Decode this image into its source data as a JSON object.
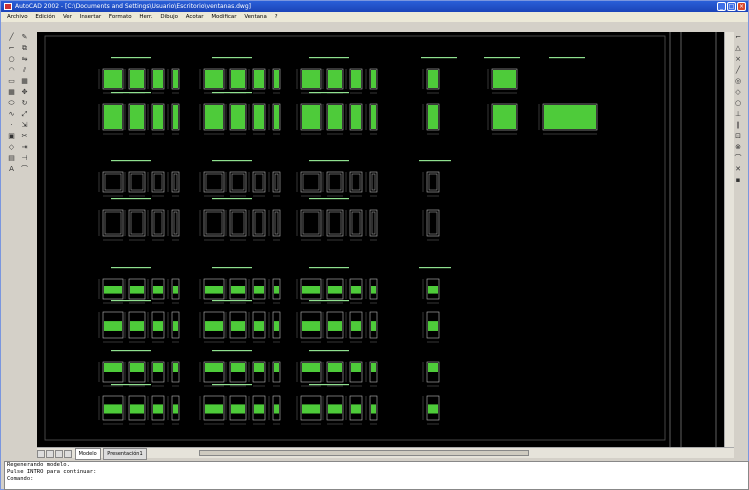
{
  "titlebar": {
    "title": "AutoCAD 2002 - [C:\\Documents and Settings\\Usuario\\Escritorio\\ventanas.dwg]"
  },
  "menubar": {
    "items": [
      "Archivo",
      "Edición",
      "Ver",
      "Insertar",
      "Formato",
      "Herr.",
      "Dibujo",
      "Acotar",
      "Modificar",
      "Ventana",
      "?"
    ]
  },
  "layout_tabs": [
    "Modelo",
    "Presentación1"
  ],
  "command_lines": [
    "Regenerando modelo.",
    "Pulse INTRO para continuar:",
    "Comando:"
  ],
  "colors": {
    "canvas": "#000000",
    "fill": "#4ecb3a",
    "line": "#bbbbbb",
    "label": "#8fe08f"
  },
  "icons": {
    "left": [
      "line-icon",
      "polyline-icon",
      "circle-icon",
      "arc-icon",
      "rectangle-icon",
      "hatch-icon",
      "text-icon",
      "erase-icon",
      "copy-icon",
      "move-icon"
    ],
    "right": [
      "osnap-endpoint-icon",
      "osnap-midpoint-icon",
      "osnap-center-icon",
      "osnap-intersection-icon"
    ]
  }
}
